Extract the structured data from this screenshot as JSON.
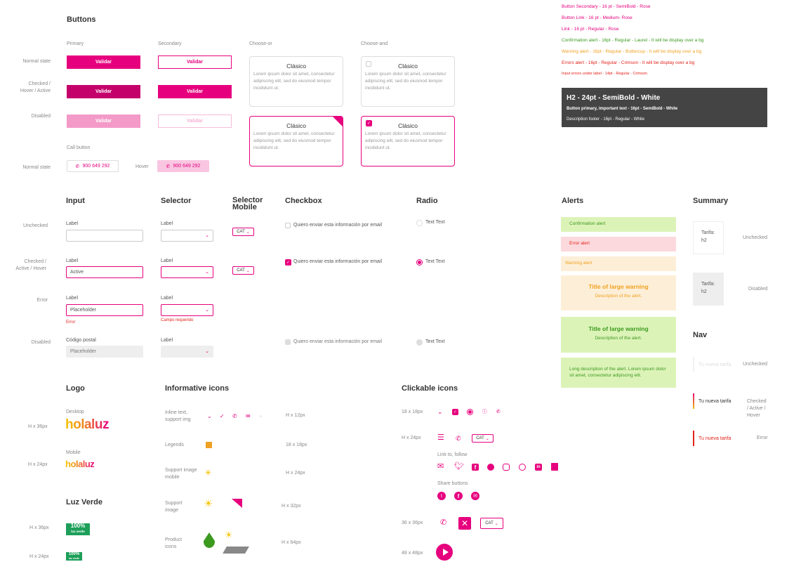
{
  "buttons": {
    "title": "Buttons",
    "col_primary": "Primary",
    "col_secondary": "Secondary",
    "col_choose_or": "Choose-or",
    "col_choose_and": "Choose-and",
    "row_normal": "Normal state",
    "row_checked": "Checked / Hover / Active",
    "row_disabled": "Disabled",
    "btn_label": "Validar",
    "card_title": "Clásico",
    "card_desc": "Lorem ipsum dolor sit amet, consectetur adipiscing elit, sed do eiusmod tempor incididunt ut.",
    "call_button_label": "Call button",
    "call_row_normal": "Normal state",
    "call_hover": "Hover",
    "phone": "900 649 292"
  },
  "typography": {
    "lines": [
      {
        "text": "Button Secondary - 16 pt - SemiBold - Rose",
        "color": "#e6007e"
      },
      {
        "text": "Button Link - 16 pt - Medium- Rose",
        "color": "#e6007e"
      },
      {
        "text": "Link - 16 pt - Regular - Rose",
        "color": "#e6007e"
      },
      {
        "text": "Confirmation alert - 16pt - Regular - Laurel - It will be display over a bg",
        "color": "#3c9a1f"
      },
      {
        "text": "Warning alert - 16pt - Regular - Buttercup - It will be display over a bg",
        "color": "#f0a122"
      },
      {
        "text": "Errors alert - 16pt - Regular - Crimson - It will be display over a bg",
        "color": "#e2231a"
      },
      {
        "text": "Input errors under label - 14pt - Regular - Crimson",
        "color": "#e2231a"
      }
    ],
    "footer_h2": "H2 - 24pt - SemiBold - White",
    "footer_primary": "Button primary, important text - 16pt - SemiBold - White",
    "footer_desc": "Description footer - 16pt - Regular - White"
  },
  "forms": {
    "input_title": "Input",
    "selector_title": "Selector",
    "selector_mobile_title": "Selector Mobile",
    "checkbox_title": "Checkbox",
    "radio_title": "Radio",
    "row_unchecked": "Unchecked",
    "row_checked": "Checked / Active / Hover",
    "row_error": "Error",
    "row_disabled": "Disabled",
    "label": "Label",
    "active_value": "Active",
    "placeholder": "Placeholder",
    "error_text": "Error",
    "required_text": "Campo requerido",
    "postal_label": "Código postal",
    "cat": "CAT",
    "checkbox_text": "Quiero enviar esta información por email",
    "radio_text": "Text Text"
  },
  "alerts": {
    "title": "Alerts",
    "confirmation": "Confirmation alert",
    "error": "Error alert",
    "warning": "Warning alert",
    "large_warning_title": "Title of large warning",
    "large_warning_desc": "Description of the alert.",
    "large_confirm_title": "Title of large warning",
    "large_confirm_desc": "Description of the alert.",
    "long_desc": "Long description of the alert. Lorem ipsum dolor sit amet, consectetur adipiscing elit."
  },
  "summary": {
    "title": "Summary",
    "card_label": "Tarifa:",
    "card_value": "h2",
    "unchecked": "Unchecked",
    "disabled": "Disabled"
  },
  "nav": {
    "title": "Nav",
    "item": "Tu nueva tarifa",
    "unchecked": "Unchecked",
    "checked": "Checked / Active / Hover",
    "error": "Error"
  },
  "logo": {
    "title": "Logo",
    "desktop": "Desktop",
    "mobile": "Mobile",
    "size_36": "H x 36px",
    "size_24": "H x 24px",
    "brand": "holaluz"
  },
  "luz_verde": {
    "title": "Luz Verde",
    "size_36": "H x 36px",
    "size_24": "H x 24px",
    "big": "100%",
    "small": "luz verde"
  },
  "informative": {
    "title": "Informative icons",
    "inline": "Inline text, support img",
    "legends": "Legends",
    "support_mobile": "Support image mobile",
    "support": "Support image",
    "product": "Product icons",
    "s12": "H x 12px",
    "s18": "18 x 18px",
    "s24": "H x 24px",
    "s32": "H x 32px",
    "s64": "H x 64px"
  },
  "clickable": {
    "title": "Clickable icons",
    "s18": "18 x 18px",
    "s24": "H x 24px",
    "link_follow": "Link to, follow",
    "share": "Share buttons",
    "s36": "36 x 36px",
    "s48": "48 x 48px",
    "cat": "CAT"
  },
  "colors": {
    "rose": "#e6007e",
    "laurel": "#3c9a1f",
    "buttercup": "#f0a122",
    "crimson": "#e2231a"
  }
}
